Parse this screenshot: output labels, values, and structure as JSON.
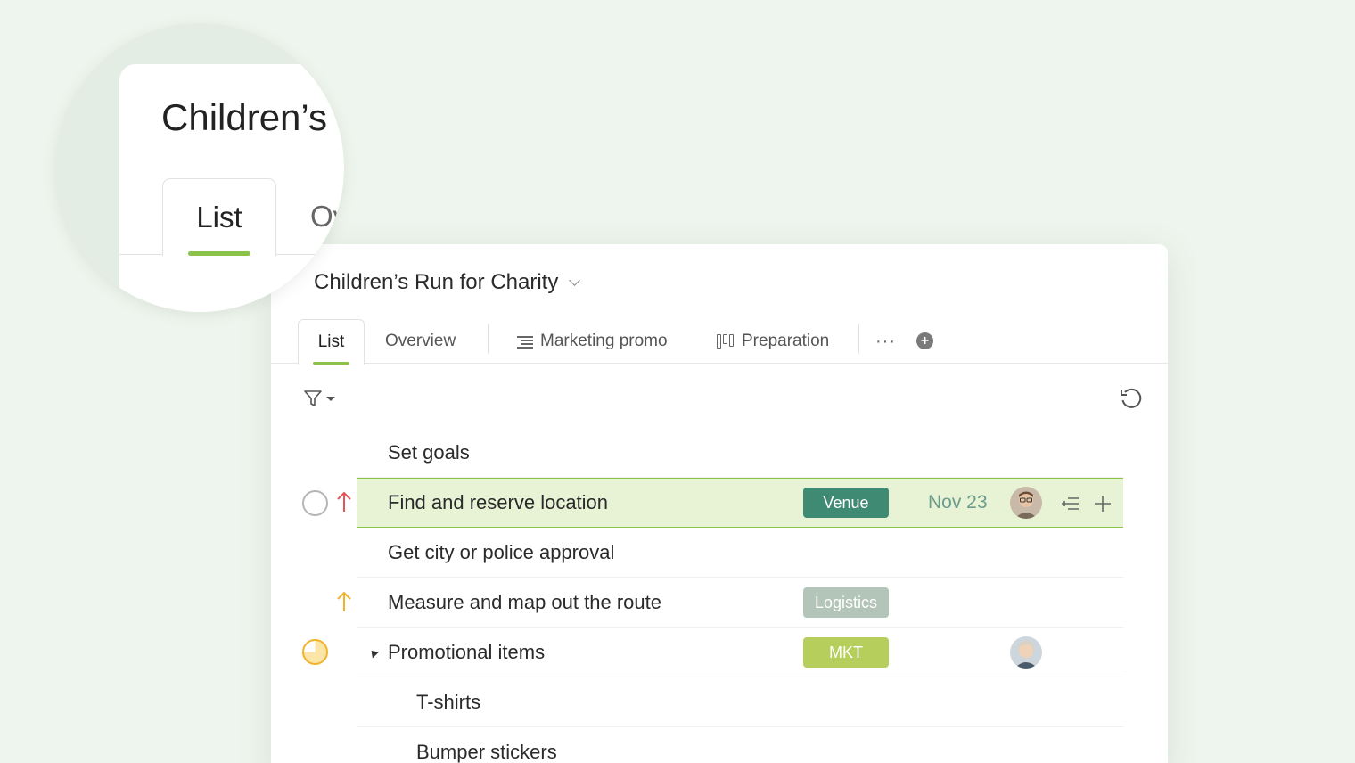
{
  "project": {
    "title": "Children’s Run for Charity"
  },
  "tabs": [
    {
      "label": "List",
      "active": true
    },
    {
      "label": "Overview"
    },
    {
      "label": "Marketing promo",
      "icon": "list-view-icon"
    },
    {
      "label": "Preparation",
      "icon": "board-view-icon"
    }
  ],
  "more_tabs": "···",
  "tasks": [
    {
      "name": "Set goals"
    },
    {
      "name": "Find and reserve location",
      "status": "not-started",
      "priority": "high",
      "tag": "Venue",
      "due": "Nov 23",
      "assignee": "avatar-man"
    },
    {
      "name": "Get city or police approval"
    },
    {
      "name": "Measure and map out the route",
      "priority": "medium",
      "tag": "Logistics"
    },
    {
      "name": "Promotional items",
      "status": "in-progress",
      "expanded": true,
      "tag": "MKT",
      "assignee": "avatar-woman"
    },
    {
      "name": "T-shirts",
      "subtask": true
    },
    {
      "name": "Bumper stickers",
      "subtask": true
    }
  ],
  "tag_colors": {
    "Venue": "#3f8a73",
    "Logistics": "#b3c4b8",
    "MKT": "#b6cf5c"
  },
  "colors": {
    "accent": "#8bc34a",
    "highlight_bg": "#e8f3d6",
    "priority_high": "#e05555",
    "priority_medium": "#f2b32a"
  },
  "zoom": {
    "title": "Children’s",
    "tab_active": "List",
    "tab_next": "Ov"
  }
}
